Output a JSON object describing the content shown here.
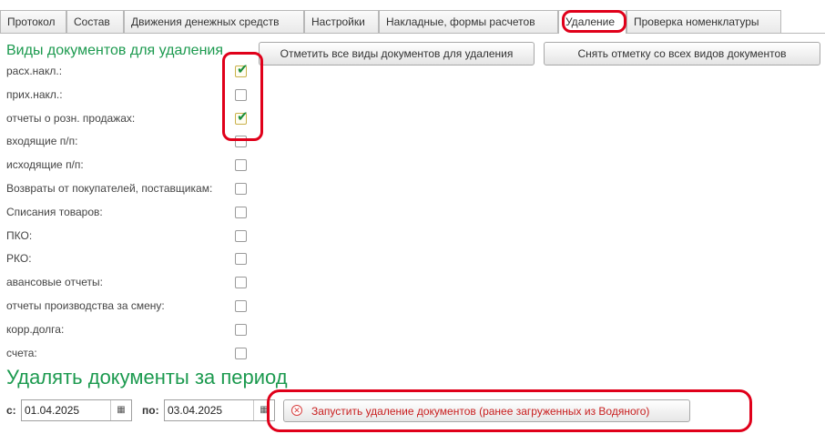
{
  "tabs": [
    {
      "label": "Протокол"
    },
    {
      "label": "Состав"
    },
    {
      "label": "Движения денежных средств"
    },
    {
      "label": "Настройки"
    },
    {
      "label": "Накладные, формы расчетов"
    },
    {
      "label": "Удаление",
      "active": true
    },
    {
      "label": "Проверка номенклатуры"
    }
  ],
  "doc_types": {
    "title": "Виды документов для удаления",
    "items": [
      {
        "label": "расх.накл.:",
        "checked": true
      },
      {
        "label": "прих.накл.:",
        "checked": false
      },
      {
        "label": "отчеты о розн. продажах:",
        "checked": true
      },
      {
        "label": "входящие п/п:",
        "checked": false
      },
      {
        "label": "исходящие п/п:",
        "checked": false
      },
      {
        "label": "Возвраты от покупателей, поставщикам:",
        "checked": false
      },
      {
        "label": "Списания товаров:",
        "checked": false
      },
      {
        "label": "ПКО:",
        "checked": false
      },
      {
        "label": "РКО:",
        "checked": false
      },
      {
        "label": "авансовые отчеты:",
        "checked": false
      },
      {
        "label": "отчеты производства за смену:",
        "checked": false
      },
      {
        "label": "корр.долга:",
        "checked": false
      },
      {
        "label": "счета:",
        "checked": false
      }
    ]
  },
  "actions": {
    "mark_all": "Отметить все виды документов для удаления",
    "unmark_all": "Снять отметку со всех видов документов"
  },
  "period": {
    "title": "Удалять документы  за период",
    "from_label": "с:",
    "from_value": "01.04.2025",
    "to_label": "по:",
    "to_value": "03.04.2025",
    "run_label": "Запустить удаление документов (ранее загруженных из Водяного)"
  },
  "colors": {
    "title_green": "#1c9a4f",
    "check_green": "#1a8f3c",
    "annotation_red": "#e0001a",
    "run_text_red": "#c81e1e"
  }
}
